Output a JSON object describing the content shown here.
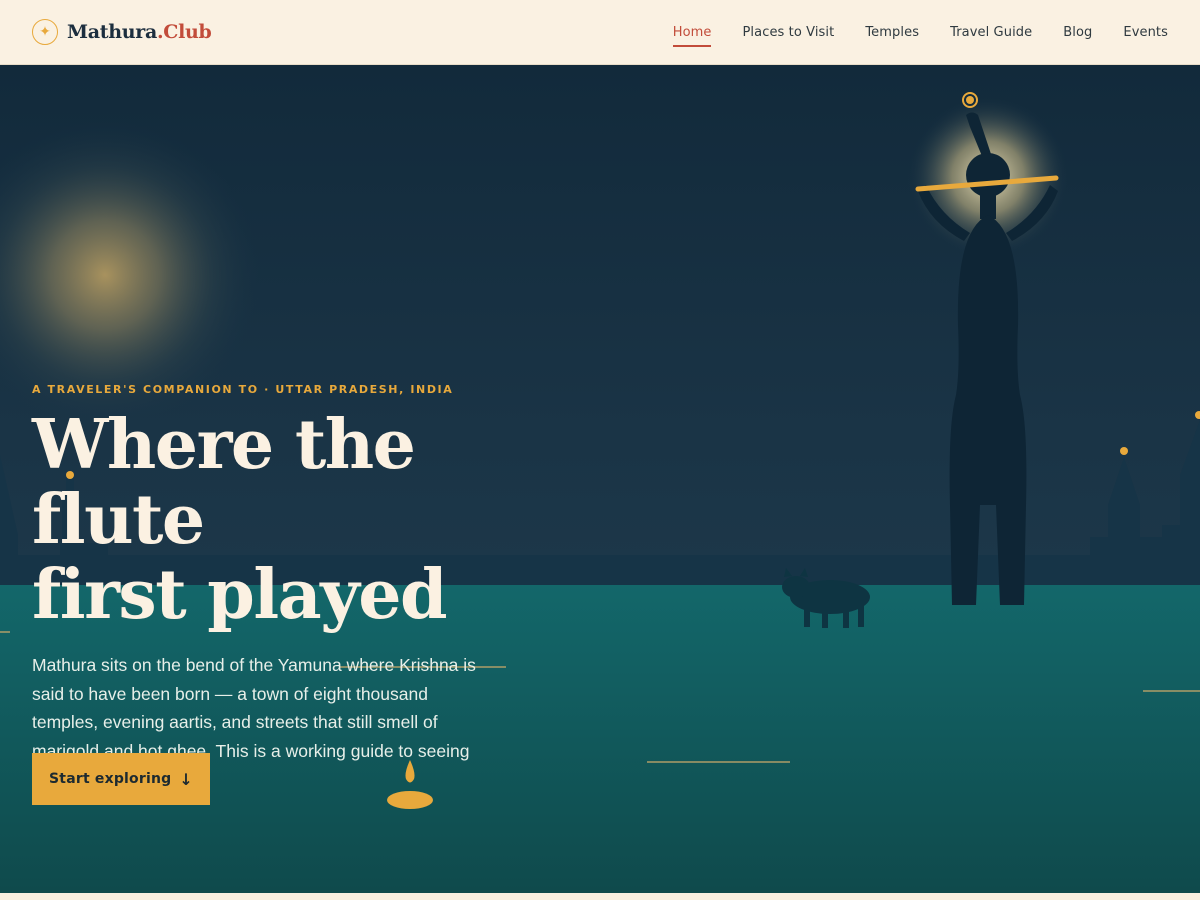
{
  "header": {
    "logo_icon": "star-compass-icon",
    "logo_text": "Mathura",
    "logo_accent": ".Club",
    "nav": [
      {
        "label": "Home",
        "active": true
      },
      {
        "label": "Places to Visit",
        "active": false
      },
      {
        "label": "Temples",
        "active": false
      },
      {
        "label": "Travel Guide",
        "active": false
      },
      {
        "label": "Blog",
        "active": false
      },
      {
        "label": "Events",
        "active": false
      }
    ]
  },
  "hero": {
    "eyebrow": "A traveler's companion to · Uttar Pradesh, India",
    "headline_line1": "Where the flute",
    "headline_line2": "first played",
    "lede": "Mathura sits on the bend of the Yamuna where Krishna is said to have been born — a town of eight thousand temples, evening aartis, and streets that still smell of marigold and hot ghee. This is a working guide to seeing it well.",
    "cta_label": "Start exploring",
    "cta_icon": "arrow-down-icon",
    "illustration": [
      "moon-glow",
      "krishna-flute-silhouette",
      "temple-skyline",
      "cow-silhouette",
      "diya-lamp",
      "yamuna-river"
    ]
  },
  "colors": {
    "accent": "#e8a93c",
    "brand_red": "#c24c3a",
    "night_sky": "#122a3b",
    "river": "#11605f",
    "cream": "#faf1e2"
  }
}
